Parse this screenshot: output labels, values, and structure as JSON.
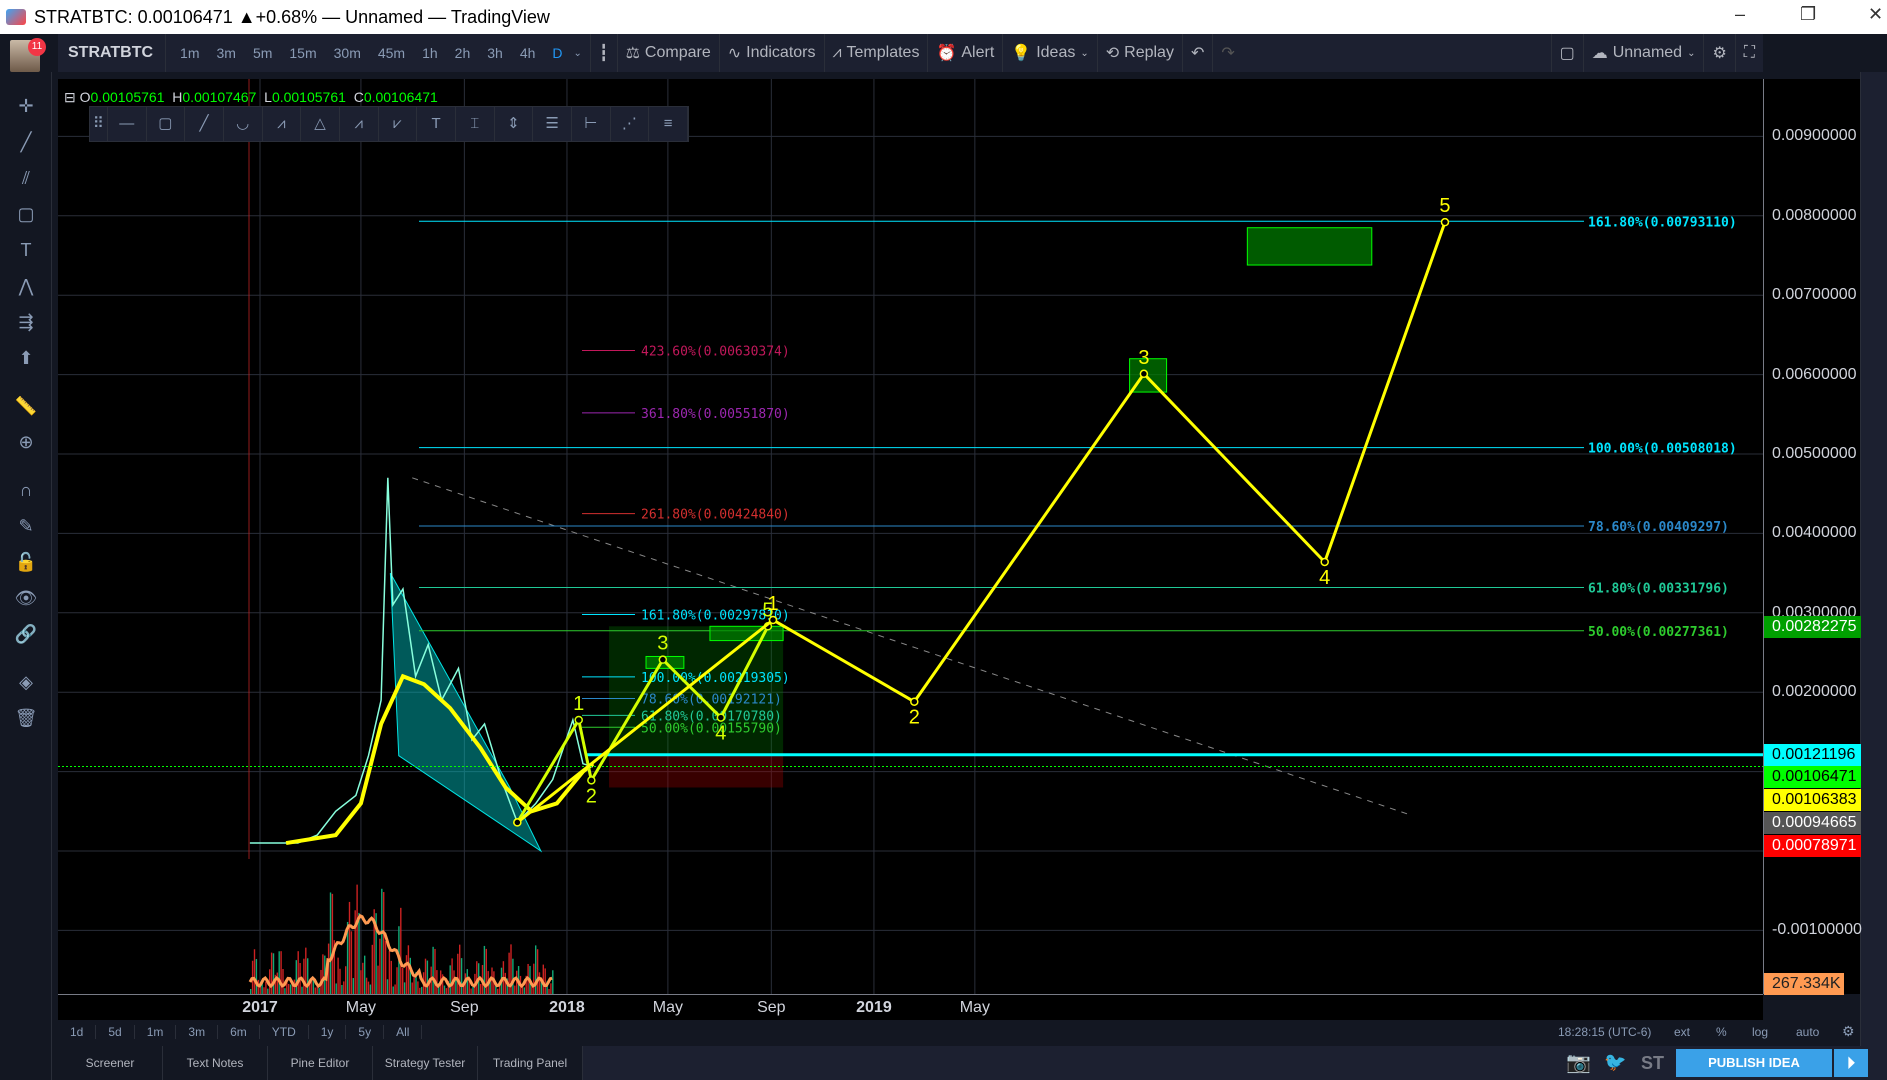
{
  "window": {
    "title": "STRATBTC: 0.00106471 ▲+0.68% — Unnamed — TradingView",
    "minimize": "–",
    "maximize": "❐",
    "close": "✕"
  },
  "user": {
    "notifications": "11"
  },
  "toolbar": {
    "symbol": "STRATBTC",
    "intervals": [
      "1m",
      "3m",
      "5m",
      "15m",
      "30m",
      "45m",
      "1h",
      "2h",
      "3h",
      "4h",
      "D"
    ],
    "active_interval": "D",
    "compare": "Compare",
    "indicators": "Indicators",
    "templates": "Templates",
    "alert": "Alert",
    "ideas": "Ideas",
    "replay": "Replay",
    "layout_name": "Unnamed"
  },
  "left_tools": [
    "crosshair-icon",
    "trendline-icon",
    "pitchfork-icon",
    "rectangle-icon",
    "text-icon",
    "pattern-icon",
    "prediction-icon",
    "arrow-up-icon",
    "ruler-icon",
    "zoom-in-icon",
    "magnet-icon",
    "stay-in-drawing-icon",
    "lock-icon",
    "eye-icon",
    "link-icon",
    "layers-icon",
    "trash-icon"
  ],
  "drawing_toolbar": [
    "horizontal-line-icon",
    "rectangle-icon",
    "trendline-icon",
    "curve-icon",
    "abcde-icon",
    "triangle-icon",
    "elliott-impulse-icon",
    "elliott-correction-icon",
    "text-icon",
    "price-range-icon",
    "date-price-range-icon",
    "fib-retracement-icon",
    "date-range-icon",
    "fib-extension-icon",
    "parallel-lines-icon"
  ],
  "ohlc": {
    "o_label": "O",
    "o": "0.00105761",
    "h_label": "H",
    "h": "0.00107467",
    "l_label": "L",
    "l": "0.00105761",
    "c_label": "C",
    "c": "0.00106471"
  },
  "price_axis": {
    "ticks": [
      "0.00900000",
      "0.00800000",
      "0.00700000",
      "0.00600000",
      "0.00500000",
      "0.00400000",
      "0.00300000",
      "0.00200000",
      "-0.00100000"
    ],
    "labels": [
      {
        "text": "0.00282275",
        "price": 0.00282275,
        "bg": "#00a000",
        "fg": "#ffffff"
      },
      {
        "text": "0.00121196",
        "price": 0.00121196,
        "bg": "#00ffff",
        "fg": "#000000"
      },
      {
        "text": "0.00106471",
        "price": 0.00106471,
        "bg": "#00ff00",
        "fg": "#000000"
      },
      {
        "text": "0.00106383",
        "price": 0.00106383,
        "bg": "#ffff00",
        "fg": "#000000"
      },
      {
        "text": "0.00094665",
        "price": 0.00094665,
        "bg": "#555555",
        "fg": "#ffffff"
      },
      {
        "text": "0.00078971",
        "price": 0.00078971,
        "bg": "#ff0000",
        "fg": "#ffffff"
      },
      {
        "text": "267.334K",
        "price": null,
        "bg": "#ff9a52",
        "fg": "#222222"
      }
    ]
  },
  "time_axis": [
    {
      "text": "2017",
      "date": "2017-01-01",
      "year": true
    },
    {
      "text": "May",
      "date": "2017-05-01"
    },
    {
      "text": "Sep",
      "date": "2017-09-01"
    },
    {
      "text": "2018",
      "date": "2018-01-01",
      "year": true
    },
    {
      "text": "May",
      "date": "2018-05-01"
    },
    {
      "text": "Sep",
      "date": "2018-09-01"
    },
    {
      "text": "2019",
      "date": "2019-01-01",
      "year": true
    },
    {
      "text": "May",
      "date": "2019-05-01"
    }
  ],
  "range_buttons": [
    "1d",
    "5d",
    "1m",
    "3m",
    "6m",
    "YTD",
    "1y",
    "5y",
    "All"
  ],
  "status": {
    "time": "18:28:15 (UTC-6)",
    "ext": "ext",
    "percent": "%",
    "log": "log",
    "auto": "auto"
  },
  "bottom_tabs": [
    "Screener",
    "Text Notes",
    "Pine Editor",
    "Strategy Tester",
    "Trading Panel"
  ],
  "bottom_right": {
    "publish": "PUBLISH IDEA",
    "st": "ST"
  },
  "chart_data": {
    "type": "candlestick",
    "symbol": "STRATBTC",
    "fib_extension_right": [
      {
        "label": "161.80%(0.00793110)",
        "price": 0.0079311,
        "color": "#00e5ff"
      },
      {
        "label": "100.00%(0.00508018)",
        "price": 0.00508018,
        "color": "#00e5ff"
      },
      {
        "label": "78.60%(0.00409297)",
        "price": 0.00409297,
        "color": "#2b88c9"
      },
      {
        "label": "61.80%(0.00331796)",
        "price": 0.00331796,
        "color": "#20c997"
      },
      {
        "label": "50.00%(0.00277361)",
        "price": 0.00277361,
        "color": "#2ecc2e"
      }
    ],
    "fib_extension_left": [
      {
        "label": "423.60%(0.00630374)",
        "price": 0.00630374,
        "color": "#c2185b"
      },
      {
        "label": "361.80%(0.00551870)",
        "price": 0.0055187,
        "color": "#9c27b0"
      },
      {
        "label": "261.80%(0.00424840)",
        "price": 0.0042484,
        "color": "#d32f2f"
      },
      {
        "label": "161.80%(0.00297810)",
        "price": 0.0029781,
        "color": "#00e5ff"
      },
      {
        "label": "100.00%(0.00219305)",
        "price": 0.00219305,
        "color": "#00e5ff"
      },
      {
        "label": "78.60%(0.00192121)",
        "price": 0.00192121,
        "color": "#2b88c9"
      },
      {
        "label": "61.80%(0.00170780)",
        "price": 0.0017078,
        "color": "#20c997"
      },
      {
        "label": "50.00%(0.00155790)",
        "price": 0.0015579,
        "color": "#2ecc2e"
      }
    ],
    "wave_big": [
      {
        "date": "2017-11-03",
        "price": 0.00036,
        "label": ""
      },
      {
        "date": "2018-09-03",
        "price": 0.00291,
        "label": "1"
      },
      {
        "date": "2019-02-18",
        "price": 0.00188,
        "label": "2"
      },
      {
        "date": "2019-11-18",
        "price": 0.00601,
        "label": "3"
      },
      {
        "date": "2020-06-20",
        "price": 0.00364,
        "label": "4"
      },
      {
        "date": "2020-11-10",
        "price": 0.00792,
        "label": "5"
      }
    ],
    "wave_small": [
      {
        "date": "2017-11-03",
        "price": 0.00036,
        "label": ""
      },
      {
        "date": "2018-01-15",
        "price": 0.00165,
        "label": "1"
      },
      {
        "date": "2018-01-30",
        "price": 0.00089,
        "label": "2"
      },
      {
        "date": "2018-04-25",
        "price": 0.00241,
        "label": "3"
      },
      {
        "date": "2018-07-03",
        "price": 0.00168,
        "label": "4"
      },
      {
        "date": "2018-08-28",
        "price": 0.00283,
        "label": "5"
      }
    ],
    "price_history": [
      [
        "2016-12-20",
        0.0001
      ],
      [
        "2017-02-15",
        0.0001
      ],
      [
        "2017-03-10",
        0.0002
      ],
      [
        "2017-04-01",
        0.0005
      ],
      [
        "2017-04-25",
        0.0007
      ],
      [
        "2017-05-10",
        0.0012
      ],
      [
        "2017-05-25",
        0.0019
      ],
      [
        "2017-06-02",
        0.0047
      ],
      [
        "2017-06-08",
        0.0031
      ],
      [
        "2017-06-20",
        0.0033
      ],
      [
        "2017-07-05",
        0.0022
      ],
      [
        "2017-07-20",
        0.0026
      ],
      [
        "2017-08-05",
        0.0019
      ],
      [
        "2017-08-25",
        0.0023
      ],
      [
        "2017-09-10",
        0.0014
      ],
      [
        "2017-09-25",
        0.0016
      ],
      [
        "2017-10-15",
        0.0009
      ],
      [
        "2017-11-03",
        0.00036
      ],
      [
        "2017-11-25",
        0.0006
      ],
      [
        "2017-12-15",
        0.0009
      ],
      [
        "2018-01-08",
        0.00165
      ],
      [
        "2018-01-20",
        0.0011
      ],
      [
        "2018-02-01",
        0.00106
      ]
    ],
    "moving_average": [
      [
        "2017-02-01",
        0.0001
      ],
      [
        "2017-04-01",
        0.0002
      ],
      [
        "2017-05-01",
        0.0006
      ],
      [
        "2017-05-25",
        0.0016
      ],
      [
        "2017-06-20",
        0.0022
      ],
      [
        "2017-07-15",
        0.0021
      ],
      [
        "2017-08-15",
        0.0018
      ],
      [
        "2017-09-20",
        0.0013
      ],
      [
        "2017-10-20",
        0.0008
      ],
      [
        "2017-11-20",
        0.0005
      ],
      [
        "2017-12-20",
        0.0006
      ],
      [
        "2018-01-20",
        0.001
      ],
      [
        "2018-02-01",
        0.0011
      ]
    ],
    "wedge": [
      [
        "2017-06-05",
        0.0035
      ],
      [
        "2017-10-25",
        0.0008
      ],
      [
        "2017-12-01",
        0.0
      ],
      [
        "2017-06-15",
        0.0012
      ]
    ],
    "trendline_dashed": [
      [
        "2017-07-01",
        0.0047
      ],
      [
        "2020-10-01",
        0.00045
      ]
    ],
    "horizontal_cyan": {
      "price": 0.00121196,
      "from": "2018-01-25"
    },
    "last_price": 0.00106471,
    "boxes": [
      {
        "from": "2020-03-20",
        "to": "2020-08-15",
        "top": 0.00785,
        "bottom": 0.00738
      },
      {
        "from": "2019-11-01",
        "to": "2019-12-15",
        "top": 0.0062,
        "bottom": 0.00578
      },
      {
        "from": "2018-04-05",
        "to": "2018-05-20",
        "top": 0.00245,
        "bottom": 0.0023
      },
      {
        "from": "2018-06-20",
        "to": "2018-09-15",
        "top": 0.00283,
        "bottom": 0.00265
      }
    ],
    "position": {
      "from": "2018-02-20",
      "to": "2018-09-15",
      "target": 0.00283,
      "entry": 0.00121196,
      "stop": 0.0008
    },
    "xlim": [
      "2016-11-01",
      "2021-05-01"
    ],
    "ylim": [
      -0.0018,
      0.0093
    ],
    "grid": true
  },
  "colors": {
    "up": "#00ff00",
    "wave": "#ffff00",
    "fib_cyan": "#00e5ff",
    "accent": "#2196f3",
    "publish": "#3aa1e8"
  }
}
